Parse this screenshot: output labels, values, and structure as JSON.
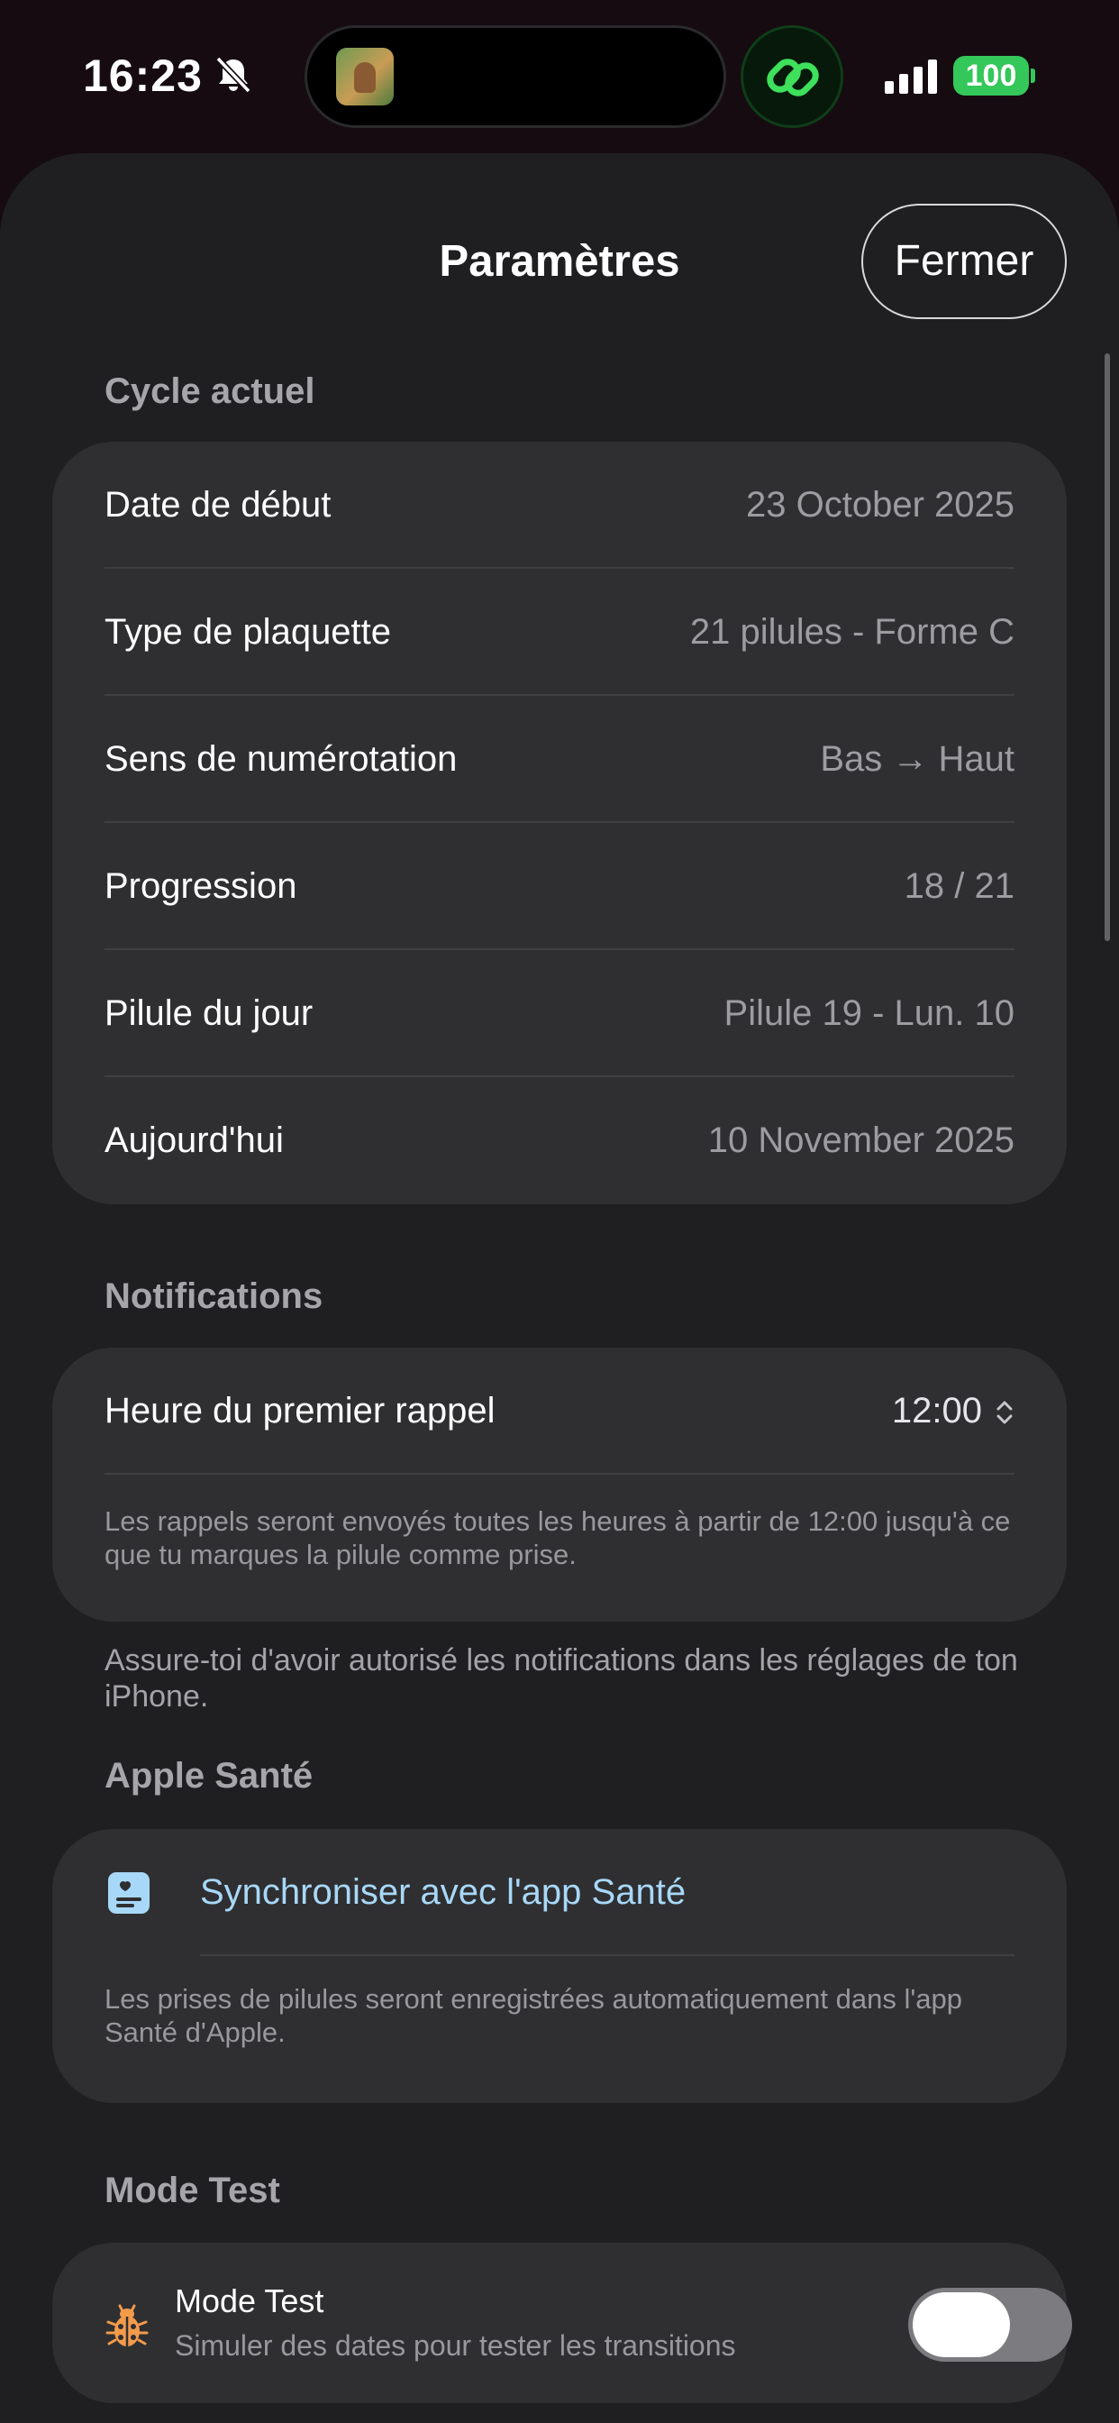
{
  "status_bar": {
    "time": "16:23",
    "battery": "100",
    "icons": [
      "bell-slash-icon",
      "now-playing-artwork",
      "link-icon",
      "cellular-signal-icon",
      "battery-icon"
    ]
  },
  "sheet": {
    "title": "Paramètres",
    "close_label": "Fermer"
  },
  "cycle": {
    "header": "Cycle actuel",
    "rows": [
      {
        "label": "Date de début",
        "value": "23 October 2025"
      },
      {
        "label": "Type de plaquette",
        "value": "21 pilules - Forme C"
      },
      {
        "label": "Sens de numérotation",
        "value": "Bas → Haut"
      },
      {
        "label": "Progression",
        "value": "18 / 21"
      },
      {
        "label": "Pilule du jour",
        "value": "Pilule 19 - Lun. 10"
      },
      {
        "label": "Aujourd'hui",
        "value": "10 November 2025"
      }
    ]
  },
  "notifications": {
    "header": "Notifications",
    "reminder_label": "Heure du premier rappel",
    "reminder_time": "12:00",
    "card_note": "Les rappels seront envoyés toutes les heures à partir de 12:00 jusqu'à ce que tu marques la pilule comme prise.",
    "footer_note": "Assure-toi d'avoir autorisé les notifications dans les réglages de ton iPhone."
  },
  "health": {
    "header": "Apple Santé",
    "sync_label": "Synchroniser avec l'app Santé",
    "note": "Les prises de pilules seront enregistrées automatiquement dans l'app Santé d'Apple."
  },
  "test_mode": {
    "header": "Mode Test",
    "title": "Mode Test",
    "subtitle": "Simuler des dates pour tester les transitions",
    "enabled": false
  },
  "colors": {
    "background": "#1f1f21",
    "card": "#2f2f31",
    "accent_link": "#a8d8f8",
    "battery_green": "#34c759",
    "bug_orange": "#f39a4b"
  }
}
